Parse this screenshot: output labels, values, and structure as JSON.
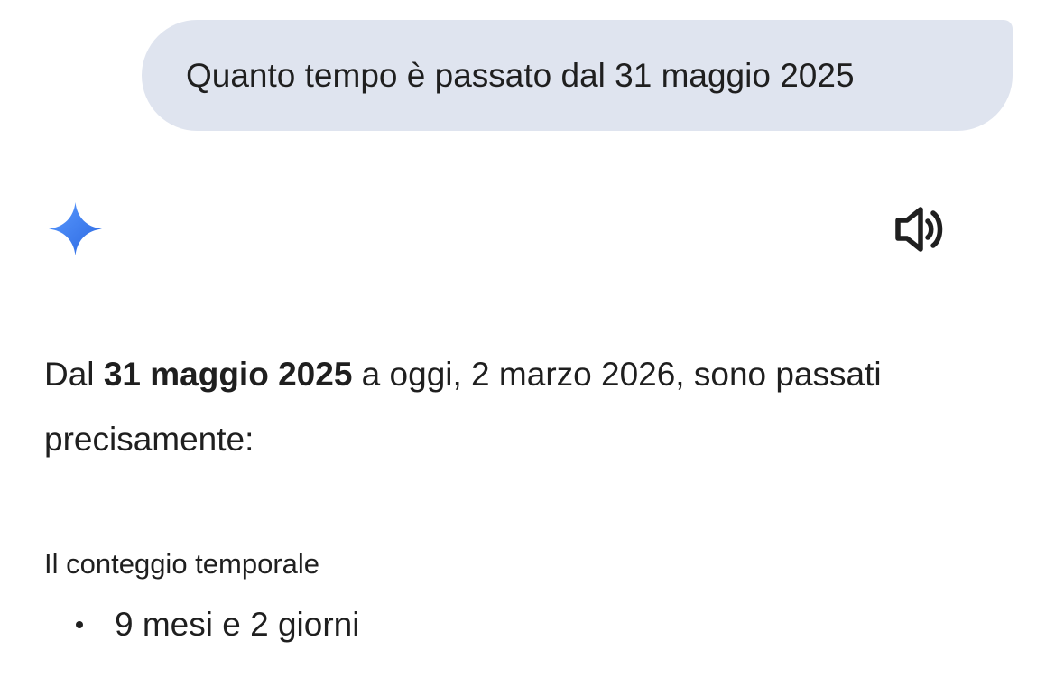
{
  "user_message": {
    "text": "Quanto tempo è passato dal 31 maggio 2025"
  },
  "icons": {
    "assistant": "sparkle-icon",
    "read_aloud": "speaker-icon"
  },
  "colors": {
    "bubble_background": "#dfe4ef",
    "sparkle_gradient_start": "#4f8ef7",
    "sparkle_gradient_end": "#2f6be6",
    "text": "#1f1f1f"
  },
  "response": {
    "intro_prefix": "Dal ",
    "intro_bold_date": "31 maggio 2025",
    "intro_suffix": " a oggi, 2 marzo 2026, sono passati precisamente:",
    "section_heading": "Il conteggio temporale",
    "items": [
      {
        "text": "9 mesi e 2 giorni"
      }
    ]
  }
}
